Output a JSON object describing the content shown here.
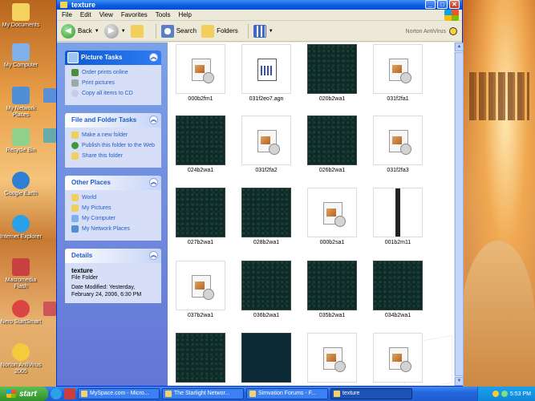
{
  "desktop": {
    "icons": [
      {
        "label": "My Documents",
        "color": "#f3d35e"
      },
      {
        "label": "My Computer",
        "color": "#7fb0e8"
      },
      {
        "label": "My Network Places",
        "color": "#4f8fd6"
      },
      {
        "label": "Recycle Bin",
        "color": "#8fd08a"
      },
      {
        "label": "Google Earth",
        "color": "#2f7fd2"
      },
      {
        "label": "Internet Explorer",
        "color": "#2aa0e8"
      },
      {
        "label": "Macromedia Flash",
        "color": "#c94040"
      },
      {
        "label": "Nero StartSmart",
        "color": "#d44"
      },
      {
        "label": "Norton AntiVirus 2005",
        "color": "#f2cc3c"
      }
    ],
    "peek_labels": [
      "Pr",
      "Sp",
      "Xe",
      "Mr",
      "Pe"
    ]
  },
  "window": {
    "title": "texture",
    "menu": [
      "File",
      "Edit",
      "View",
      "Favorites",
      "Tools",
      "Help"
    ],
    "toolbar": {
      "back_label": "Back",
      "search_label": "Search",
      "folders_label": "Folders",
      "norton_label": "Norton AntiVirus"
    }
  },
  "left_pane": {
    "picture_tasks": {
      "title": "Picture Tasks",
      "items": [
        "Order prints online",
        "Print pictures",
        "Copy all items to CD"
      ]
    },
    "file_folder_tasks": {
      "title": "File and Folder Tasks",
      "items": [
        "Make a new folder",
        "Publish this folder to the Web",
        "Share this folder"
      ]
    },
    "other_places": {
      "title": "Other Places",
      "items": [
        "World",
        "My Pictures",
        "My Computer",
        "My Network Places"
      ]
    },
    "details": {
      "title": "Details",
      "name": "texture",
      "type": "File Folder",
      "modified": "Date Modified: Yesterday, February 24, 2006, 6:30 PM"
    }
  },
  "files": [
    {
      "name": "000b2fm1",
      "kind": "doc"
    },
    {
      "name": "031f2eo7.agn",
      "kind": "cal"
    },
    {
      "name": "020b2wa1",
      "kind": "dark"
    },
    {
      "name": "031f2fa1",
      "kind": "doc"
    },
    {
      "name": "024b2wa1",
      "kind": "dark"
    },
    {
      "name": "031f2fa2",
      "kind": "doc"
    },
    {
      "name": "026b2wa1",
      "kind": "dark"
    },
    {
      "name": "031f2fa3",
      "kind": "doc"
    },
    {
      "name": "027b2wa1",
      "kind": "dark"
    },
    {
      "name": "028b2wa1",
      "kind": "dark"
    },
    {
      "name": "000b2sa1",
      "kind": "doc"
    },
    {
      "name": "001b2m11",
      "kind": "stripe"
    },
    {
      "name": "037b2wa1",
      "kind": "doc"
    },
    {
      "name": "036b2wa1",
      "kind": "dark"
    },
    {
      "name": "035b2wa1",
      "kind": "dark"
    },
    {
      "name": "034b2wa1",
      "kind": "dark"
    },
    {
      "name": "",
      "kind": "dark"
    },
    {
      "name": "",
      "kind": "blue"
    },
    {
      "name": "",
      "kind": "doc"
    },
    {
      "name": "",
      "kind": "doc"
    }
  ],
  "taskbar": {
    "start_label": "start",
    "tasks": [
      "MySpace.com - Micro...",
      "The Starlight Networ...",
      "Simvation Forums - F...",
      "texture"
    ],
    "clock": "5:53 PM"
  }
}
